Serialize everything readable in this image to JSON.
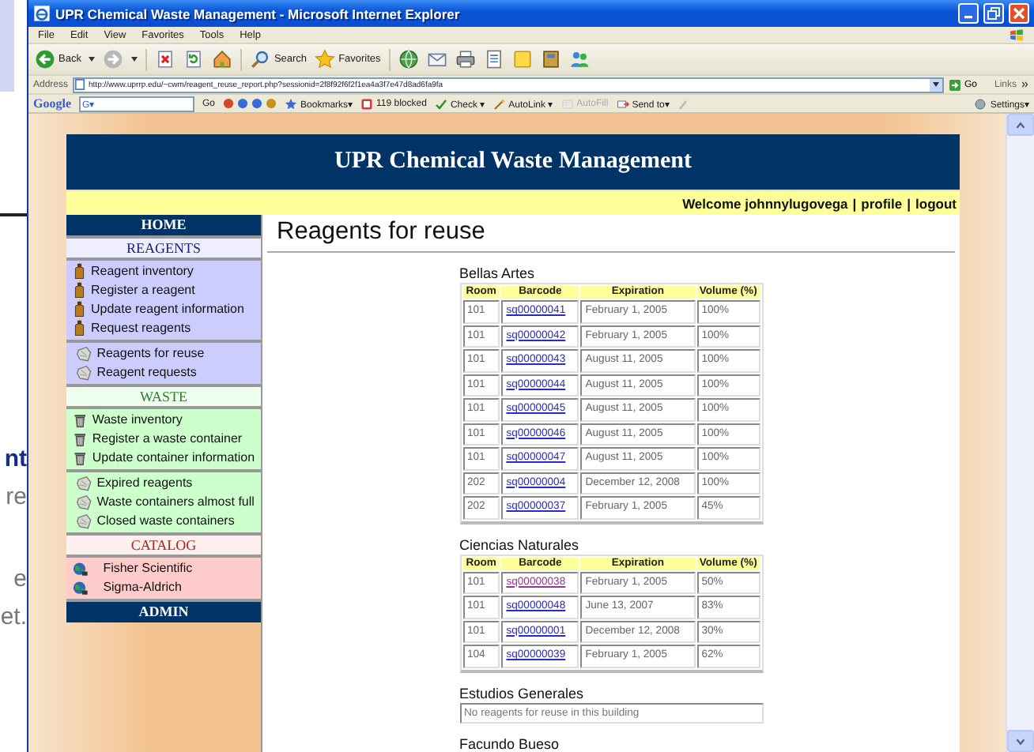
{
  "background_window": {
    "fragments": [
      "nt",
      "re",
      "e",
      "et."
    ]
  },
  "window": {
    "title": "UPR Chemical Waste Management - Microsoft Internet Explorer"
  },
  "menu": [
    "File",
    "Edit",
    "View",
    "Favorites",
    "Tools",
    "Help"
  ],
  "toolbar": [
    {
      "kind": "back",
      "label": "Back"
    },
    {
      "kind": "forward"
    },
    {
      "kind": "stop"
    },
    {
      "kind": "refresh"
    },
    {
      "kind": "home"
    },
    {
      "kind": "search",
      "label": "Search"
    },
    {
      "kind": "favorites",
      "label": "Favorites"
    },
    {
      "kind": "media"
    },
    {
      "kind": "mail"
    },
    {
      "kind": "print"
    },
    {
      "kind": "edit"
    },
    {
      "kind": "discuss"
    },
    {
      "kind": "research"
    },
    {
      "kind": "messenger"
    }
  ],
  "address_bar": {
    "label": "Address",
    "url": "http://www.uprrp.edu/~cwm/reagent_reuse_report.php?sessionid=2f8f92f6f2f1ea4a3f7e47d8ad6fa9fa",
    "go": "Go",
    "links": "Links"
  },
  "google_bar": {
    "logo": "Google",
    "g_menu": "G▾",
    "go": "Go",
    "items": [
      {
        "kind": "star",
        "label": "Bookmarks▾",
        "disabled": false
      },
      {
        "kind": "block",
        "label": "119 blocked",
        "disabled": false
      },
      {
        "kind": "check",
        "label": "Check ▾",
        "disabled": false
      },
      {
        "kind": "wand",
        "label": "AutoLink ▾",
        "disabled": false
      },
      {
        "kind": "fill",
        "label": "AutoFill",
        "disabled": true
      },
      {
        "kind": "send",
        "label": "Send to▾",
        "disabled": false
      }
    ],
    "settings": "Settings▾"
  },
  "page": {
    "title": "UPR Chemical Waste Management",
    "welcome": {
      "text": "Welcome johnnylugovega",
      "separator": "|",
      "links": [
        "profile",
        "logout"
      ]
    },
    "nav": [
      {
        "title": "HOME",
        "kind": "home"
      },
      {
        "title": "REAGENTS",
        "kind": "reagents",
        "groups": [
          [
            {
              "kind": "bottle",
              "label": "Reagent inventory"
            },
            {
              "kind": "bottle",
              "label": "Register a reagent"
            },
            {
              "kind": "bottle",
              "label": "Update reagent information"
            },
            {
              "kind": "bottle",
              "label": "Request reagents"
            }
          ],
          [
            {
              "kind": "paper",
              "label": "Reagents for reuse"
            },
            {
              "kind": "paper",
              "label": "Reagent requests"
            }
          ]
        ]
      },
      {
        "title": "WASTE",
        "kind": "waste",
        "groups": [
          [
            {
              "kind": "bin",
              "label": "Waste inventory"
            },
            {
              "kind": "bin",
              "label": "Register a waste container"
            },
            {
              "kind": "bin",
              "label": "Update container information"
            }
          ],
          [
            {
              "kind": "paper",
              "label": "Expired reagents"
            },
            {
              "kind": "paper",
              "label": "Waste containers almost full"
            },
            {
              "kind": "paper",
              "label": "Closed waste containers"
            }
          ]
        ]
      },
      {
        "title": "CATALOG",
        "kind": "catalog",
        "groups": [
          [
            {
              "kind": "globe",
              "label": "Fisher Scientific"
            },
            {
              "kind": "globe",
              "label": "Sigma-Aldrich"
            }
          ]
        ]
      },
      {
        "title": "ADMIN",
        "kind": "home"
      }
    ],
    "heading": "Reagents for reuse",
    "buildings": [
      {
        "name": "Bellas Artes",
        "columns": [
          "Room",
          "Barcode",
          "Expiration",
          "Volume (%)"
        ],
        "rows": [
          {
            "room": "101",
            "barcode": "sq00000041",
            "visited": false,
            "expiration": "February 1, 2005",
            "volume": "100%"
          },
          {
            "room": "101",
            "barcode": "sq00000042",
            "visited": false,
            "expiration": "February 1, 2005",
            "volume": "100%"
          },
          {
            "room": "101",
            "barcode": "sq00000043",
            "visited": false,
            "expiration": "August 11, 2005",
            "volume": "100%"
          },
          {
            "room": "101",
            "barcode": "sq00000044",
            "visited": false,
            "expiration": "August 11, 2005",
            "volume": "100%"
          },
          {
            "room": "101",
            "barcode": "sq00000045",
            "visited": false,
            "expiration": "August 11, 2005",
            "volume": "100%"
          },
          {
            "room": "101",
            "barcode": "sq00000046",
            "visited": false,
            "expiration": "August 11, 2005",
            "volume": "100%"
          },
          {
            "room": "101",
            "barcode": "sq00000047",
            "visited": false,
            "expiration": "August 11, 2005",
            "volume": "100%"
          },
          {
            "room": "202",
            "barcode": "sq00000004",
            "visited": false,
            "expiration": "December 12, 2008",
            "volume": "100%"
          },
          {
            "room": "202",
            "barcode": "sq00000037",
            "visited": false,
            "expiration": "February 1, 2005",
            "volume": "45%"
          }
        ]
      },
      {
        "name": "Ciencias Naturales",
        "columns": [
          "Room",
          "Barcode",
          "Expiration",
          "Volume (%)"
        ],
        "rows": [
          {
            "room": "101",
            "barcode": "sq00000038",
            "visited": true,
            "expiration": "February 1, 2005",
            "volume": "50%"
          },
          {
            "room": "101",
            "barcode": "sq00000048",
            "visited": false,
            "expiration": "June 13, 2007",
            "volume": "83%"
          },
          {
            "room": "101",
            "barcode": "sq00000001",
            "visited": false,
            "expiration": "December 12, 2008",
            "volume": "30%"
          },
          {
            "room": "104",
            "barcode": "sq00000039",
            "visited": false,
            "expiration": "February 1, 2005",
            "volume": "62%"
          }
        ]
      },
      {
        "name": "Estudios Generales",
        "message": "No reagents for reuse in this building"
      },
      {
        "name": "Facundo Bueso"
      }
    ]
  }
}
